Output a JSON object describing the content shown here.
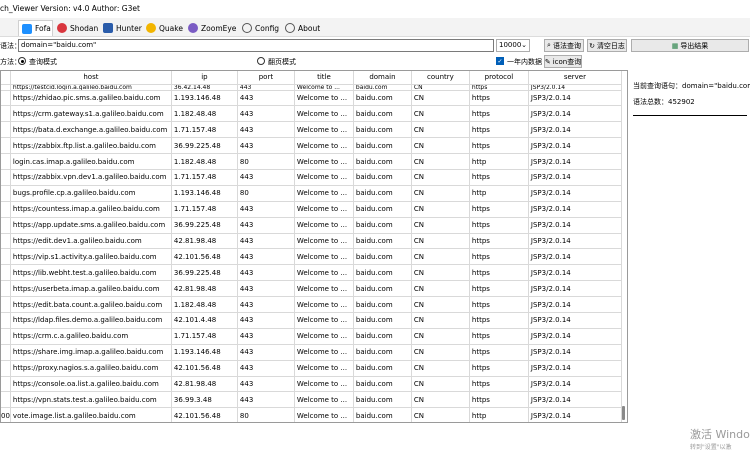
{
  "window": {
    "title": "ch_Viewer  Version:  v4.0  Author:  G3et"
  },
  "tabs": [
    {
      "label": "Fofa",
      "icon": "fofa-icon",
      "color": "#1e90ff",
      "active": true
    },
    {
      "label": "Shodan",
      "icon": "shodan-icon",
      "color": "#d9363e",
      "active": false
    },
    {
      "label": "Hunter",
      "icon": "hunter-icon",
      "color": "#2a5caa",
      "active": false
    },
    {
      "label": "Quake",
      "icon": "quake-icon",
      "color": "#f2b500",
      "active": false
    },
    {
      "label": "ZoomEye",
      "icon": "zoomeye-icon",
      "color": "#7b5cc4",
      "active": false
    },
    {
      "label": "Config",
      "icon": "gear-icon",
      "color": "#555555",
      "active": false
    },
    {
      "label": "About",
      "icon": "info-icon",
      "color": "#555555",
      "active": false
    }
  ],
  "toolbar": {
    "query_label": "语法：",
    "query_value": "domain=\"baidu.com\"",
    "size_value": "10000",
    "search_button": "语法查询",
    "clear_button": "清空日志",
    "export_button": "导出结果"
  },
  "options": {
    "mode_label": "方法：",
    "query_mode": "查询模式",
    "page_mode": "翻页模式",
    "one_year": "一年内数据",
    "icon_query": "icon查询"
  },
  "table": {
    "columns": [
      "host",
      "ip",
      "port",
      "title",
      "domain",
      "country",
      "protocol",
      "server"
    ],
    "top_partial": [
      "https://testcid.login.a.galileo.baidu.com",
      "36.42.14.48",
      "443",
      "Welcome to ...",
      "baidu.com",
      "CN",
      "https",
      "JSP3/2.0.14"
    ],
    "rows": [
      {
        "idx": "",
        "host": "https://zhidao.pic.sms.a.galileo.baidu.com",
        "ip": "1.193.146.48",
        "port": "443",
        "title": "Welcome to ...",
        "domain": "baidu.com",
        "country": "CN",
        "protocol": "https",
        "server": "JSP3/2.0.14"
      },
      {
        "idx": "",
        "host": "https://crm.gateway.s1.a.galileo.baidu.com",
        "ip": "1.182.48.48",
        "port": "443",
        "title": "Welcome to ...",
        "domain": "baidu.com",
        "country": "CN",
        "protocol": "https",
        "server": "JSP3/2.0.14"
      },
      {
        "idx": "",
        "host": "https://bata.d.exchange.a.galileo.baidu.com",
        "ip": "1.71.157.48",
        "port": "443",
        "title": "Welcome to ...",
        "domain": "baidu.com",
        "country": "CN",
        "protocol": "https",
        "server": "JSP3/2.0.14"
      },
      {
        "idx": "",
        "host": "https://zabbix.ftp.list.a.galileo.baidu.com",
        "ip": "36.99.225.48",
        "port": "443",
        "title": "Welcome to ...",
        "domain": "baidu.com",
        "country": "CN",
        "protocol": "https",
        "server": "JSP3/2.0.14"
      },
      {
        "idx": "",
        "host": "login.cas.imap.a.galileo.baidu.com",
        "ip": "1.182.48.48",
        "port": "80",
        "title": "Welcome to ...",
        "domain": "baidu.com",
        "country": "CN",
        "protocol": "http",
        "server": "JSP3/2.0.14"
      },
      {
        "idx": "",
        "host": "https://zabbix.vpn.dev1.a.galileo.baidu.com",
        "ip": "1.71.157.48",
        "port": "443",
        "title": "Welcome to ...",
        "domain": "baidu.com",
        "country": "CN",
        "protocol": "https",
        "server": "JSP3/2.0.14"
      },
      {
        "idx": "",
        "host": "bugs.profile.cp.a.galileo.baidu.com",
        "ip": "1.193.146.48",
        "port": "80",
        "title": "Welcome to ...",
        "domain": "baidu.com",
        "country": "CN",
        "protocol": "http",
        "server": "JSP3/2.0.14"
      },
      {
        "idx": "",
        "host": "https://countess.imap.a.galileo.baidu.com",
        "ip": "1.71.157.48",
        "port": "443",
        "title": "Welcome to ...",
        "domain": "baidu.com",
        "country": "CN",
        "protocol": "https",
        "server": "JSP3/2.0.14"
      },
      {
        "idx": "",
        "host": "https://app.update.sms.a.galileo.baidu.com",
        "ip": "36.99.225.48",
        "port": "443",
        "title": "Welcome to ...",
        "domain": "baidu.com",
        "country": "CN",
        "protocol": "https",
        "server": "JSP3/2.0.14"
      },
      {
        "idx": "",
        "host": "https://edit.dev1.a.galileo.baidu.com",
        "ip": "42.81.98.48",
        "port": "443",
        "title": "Welcome to ...",
        "domain": "baidu.com",
        "country": "CN",
        "protocol": "https",
        "server": "JSP3/2.0.14"
      },
      {
        "idx": "",
        "host": "https://vip.s1.activity.a.galileo.baidu.com",
        "ip": "42.101.56.48",
        "port": "443",
        "title": "Welcome to ...",
        "domain": "baidu.com",
        "country": "CN",
        "protocol": "https",
        "server": "JSP3/2.0.14"
      },
      {
        "idx": "",
        "host": "https://lib.webht.test.a.galileo.baidu.com",
        "ip": "36.99.225.48",
        "port": "443",
        "title": "Welcome to ...",
        "domain": "baidu.com",
        "country": "CN",
        "protocol": "https",
        "server": "JSP3/2.0.14"
      },
      {
        "idx": "",
        "host": "https://userbeta.imap.a.galileo.baidu.com",
        "ip": "42.81.98.48",
        "port": "443",
        "title": "Welcome to ...",
        "domain": "baidu.com",
        "country": "CN",
        "protocol": "https",
        "server": "JSP3/2.0.14"
      },
      {
        "idx": "",
        "host": "https://edit.bata.count.a.galileo.baidu.com",
        "ip": "1.182.48.48",
        "port": "443",
        "title": "Welcome to ...",
        "domain": "baidu.com",
        "country": "CN",
        "protocol": "https",
        "server": "JSP3/2.0.14"
      },
      {
        "idx": "",
        "host": "https://ldap.files.demo.a.galileo.baidu.com",
        "ip": "42.101.4.48",
        "port": "443",
        "title": "Welcome to ...",
        "domain": "baidu.com",
        "country": "CN",
        "protocol": "https",
        "server": "JSP3/2.0.14"
      },
      {
        "idx": "",
        "host": "https://crm.c.a.galileo.baidu.com",
        "ip": "1.71.157.48",
        "port": "443",
        "title": "Welcome to ...",
        "domain": "baidu.com",
        "country": "CN",
        "protocol": "https",
        "server": "JSP3/2.0.14"
      },
      {
        "idx": "",
        "host": "https://share.img.imap.a.galileo.baidu.com",
        "ip": "1.193.146.48",
        "port": "443",
        "title": "Welcome to ...",
        "domain": "baidu.com",
        "country": "CN",
        "protocol": "https",
        "server": "JSP3/2.0.14"
      },
      {
        "idx": "",
        "host": "https://proxy.nagios.s.a.galileo.baidu.com",
        "ip": "42.101.56.48",
        "port": "443",
        "title": "Welcome to ...",
        "domain": "baidu.com",
        "country": "CN",
        "protocol": "https",
        "server": "JSP3/2.0.14"
      },
      {
        "idx": "",
        "host": "https://console.oa.list.a.galileo.baidu.com",
        "ip": "42.81.98.48",
        "port": "443",
        "title": "Welcome to ...",
        "domain": "baidu.com",
        "country": "CN",
        "protocol": "https",
        "server": "JSP3/2.0.14"
      },
      {
        "idx": "",
        "host": "https://vpn.stats.test.a.galileo.baidu.com",
        "ip": "36.99.3.48",
        "port": "443",
        "title": "Welcome to ...",
        "domain": "baidu.com",
        "country": "CN",
        "protocol": "https",
        "server": "JSP3/2.0.14"
      },
      {
        "idx": "00",
        "host": "vote.image.list.a.galileo.baidu.com",
        "ip": "42.101.56.48",
        "port": "80",
        "title": "Welcome to ...",
        "domain": "baidu.com",
        "country": "CN",
        "protocol": "http",
        "server": "JSP3/2.0.14"
      }
    ]
  },
  "right_panel": {
    "query_line": "当前查询语句：domain=\"baidu.com\"",
    "total_line": "语法总数：452902"
  },
  "watermark": {
    "line1": "激活 Windo",
    "line2": "转到\"设置\"以激"
  }
}
